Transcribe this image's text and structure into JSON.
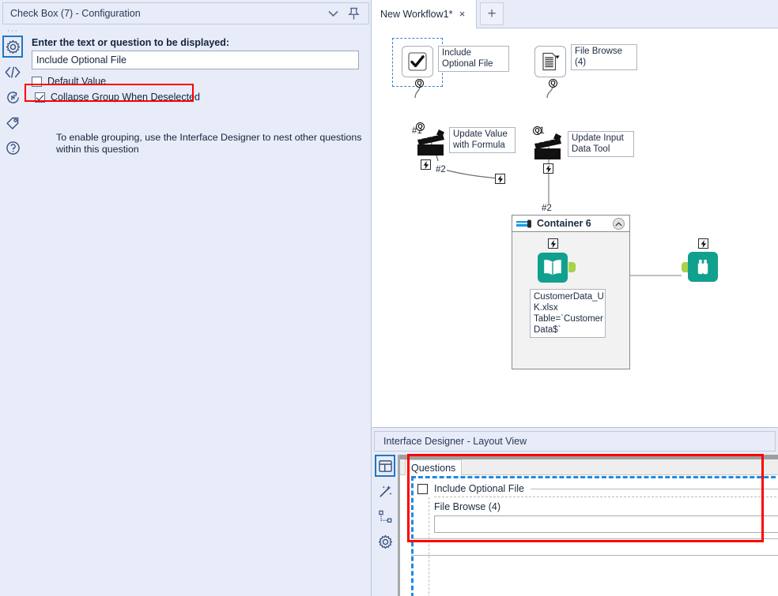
{
  "config_panel": {
    "title": "Check Box (7) - Configuration",
    "titlebar_icons": {
      "collapse": "chevron-down-icon",
      "pin": "pin-icon"
    },
    "sidebar_items": [
      {
        "name": "configuration",
        "icon": "gear-icon",
        "active": true
      },
      {
        "name": "xml-view",
        "icon": "code-brackets-icon",
        "active": false
      },
      {
        "name": "annotation",
        "icon": "circle-arrow-icon",
        "active": false
      },
      {
        "name": "labels",
        "icon": "tag-icon",
        "active": false
      },
      {
        "name": "help",
        "icon": "question-circle-icon",
        "active": false
      }
    ],
    "question_label": "Enter the text or question to be displayed:",
    "question_value": "Include Optional File",
    "question_placeholder": "",
    "default_value": {
      "label": "Default Value",
      "checked": false
    },
    "collapse_group": {
      "label": "Collapse Group When Deselected",
      "checked": true,
      "highlight_color": "#fe0000"
    },
    "hint": "To enable grouping, use the Interface Designer to nest other questions within this question"
  },
  "tabs": {
    "active_tab": "New Workflow1*",
    "close_label": "×",
    "new_tab_label": "+"
  },
  "canvas": {
    "tools": [
      {
        "id": "checkbox7",
        "icon": "checkbox-tool-icon",
        "annotation": "Include Optional File",
        "port_label": "Q",
        "connection_label": "#1",
        "selected": true
      },
      {
        "id": "filebrowse4",
        "icon": "file-browse-tool-icon",
        "annotation": "File Browse (4)",
        "port_label": "Q",
        "connection_label": "#1",
        "selected": false
      },
      {
        "id": "action-update-value",
        "icon": "action-clapperboard-icon",
        "annotation": "Update Value with Formula",
        "port_label": "Q",
        "connection_label": "#2",
        "selected": false
      },
      {
        "id": "action-update-input",
        "icon": "action-clapperboard-icon",
        "annotation": "Update Input Data Tool",
        "port_label": "Q",
        "connection_label": "#2",
        "selected": false
      }
    ],
    "container": {
      "title": "Container 6",
      "toggle_icon": "container-toggle-icon",
      "collapse_icon": "chevron-up-circle-icon",
      "input_tool": {
        "icon": "input-data-book-icon",
        "color": "#11a08d"
      },
      "input_annotation": "CustomerData_UK.xlsx\nTable=`Customer Data$`",
      "input_annotation_lines": [
        "CustomerData_U",
        "K.xlsx",
        "Table=`Customer",
        "Data$`"
      ]
    },
    "browse_tool": {
      "icon": "browse-binoculars-icon",
      "color": "#11a08d"
    }
  },
  "interface_designer": {
    "title": "Interface Designer - Layout View",
    "sidebar_items": [
      {
        "name": "layout-view",
        "icon": "layout-panel-icon",
        "active": true
      },
      {
        "name": "test-view",
        "icon": "magic-wand-icon",
        "active": false
      },
      {
        "name": "tree-view",
        "icon": "tree-nodes-icon",
        "active": false
      },
      {
        "name": "properties",
        "icon": "gear-icon",
        "active": false
      }
    ],
    "tab_label": "Questions",
    "question_checkbox": {
      "label": "Include Optional File",
      "checked": false
    },
    "nested_question": {
      "label": "File Browse (4)",
      "value": "",
      "placeholder": ""
    },
    "highlight_color": "#fe0000",
    "group_outline_color": "#1f8ae0"
  },
  "colors": {
    "panel_bg": "#e8ecf8",
    "canvas_bg": "#ffffff",
    "accent_blue": "#1f78c1",
    "tool_teal": "#11a08d",
    "port_green": "#a8d24a",
    "highlight_red": "#fe0000"
  }
}
